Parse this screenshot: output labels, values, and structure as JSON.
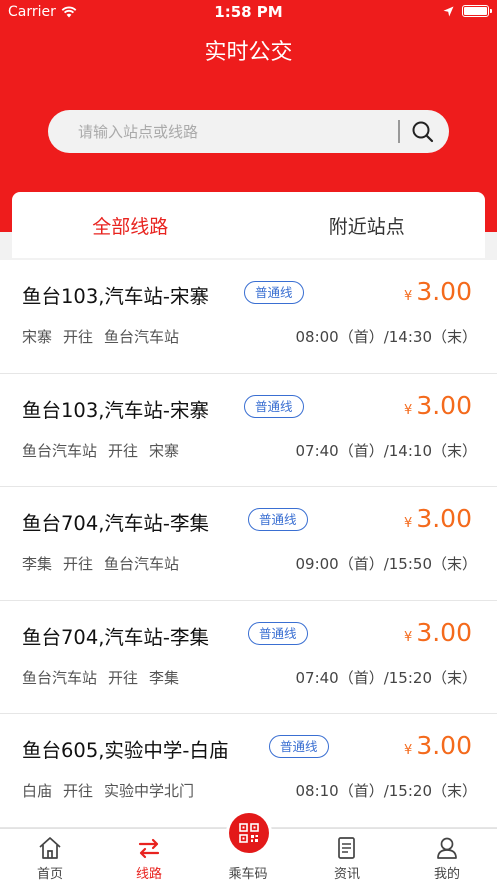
{
  "status_bar": {
    "carrier": "Carrier",
    "time": "1:58 PM"
  },
  "header": {
    "title": "实时公交"
  },
  "search": {
    "placeholder": "请输入站点或线路"
  },
  "tabs": [
    {
      "label": "全部线路",
      "active": true
    },
    {
      "label": "附近站点",
      "active": false
    }
  ],
  "routes": [
    {
      "name": "鱼台103,汽车站-宋寨",
      "type": "普通线",
      "currency": "¥",
      "price": "3.00",
      "from": "宋寨",
      "direction": "开往",
      "to": "鱼台汽车站",
      "schedule": "08:00（首）/14:30（末）"
    },
    {
      "name": "鱼台103,汽车站-宋寨",
      "type": "普通线",
      "currency": "¥",
      "price": "3.00",
      "from": "鱼台汽车站",
      "direction": "开往",
      "to": "宋寨",
      "schedule": "07:40（首）/14:10（末）"
    },
    {
      "name": "鱼台704,汽车站-李集",
      "type": "普通线",
      "currency": "¥",
      "price": "3.00",
      "from": "李集",
      "direction": "开往",
      "to": "鱼台汽车站",
      "schedule": "09:00（首）/15:50（末）"
    },
    {
      "name": "鱼台704,汽车站-李集",
      "type": "普通线",
      "currency": "¥",
      "price": "3.00",
      "from": "鱼台汽车站",
      "direction": "开往",
      "to": "李集",
      "schedule": "07:40（首）/15:20（末）"
    },
    {
      "name": "鱼台605,实验中学-白庙",
      "type": "普通线",
      "currency": "¥",
      "price": "3.00",
      "from": "白庙",
      "direction": "开往",
      "to": "实验中学北门",
      "schedule": "08:10（首）/15:20（末）"
    }
  ],
  "nav": [
    {
      "label": "首页",
      "icon": "home-icon",
      "active": false
    },
    {
      "label": "线路",
      "icon": "route-switch-icon",
      "active": true
    },
    {
      "label": "乘车码",
      "icon": "qr-code-icon",
      "active": false
    },
    {
      "label": "资讯",
      "icon": "news-icon",
      "active": false
    },
    {
      "label": "我的",
      "icon": "profile-icon",
      "active": false
    }
  ],
  "colors": {
    "brand_red": "#ee1c1c",
    "price_orange": "#f46a1c",
    "badge_blue": "#3a6fd2"
  }
}
